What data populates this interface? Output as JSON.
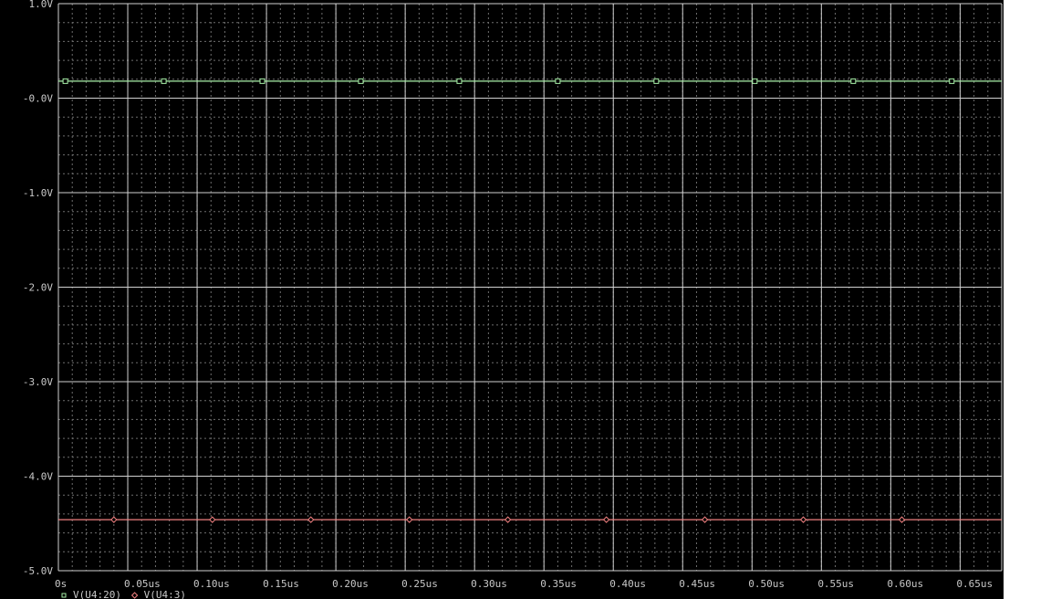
{
  "chart_data": {
    "type": "line",
    "title": "",
    "xlabel": "",
    "ylabel": "",
    "xlim": [
      0,
      0.68
    ],
    "ylim": [
      -5.0,
      1.0
    ],
    "grid": true,
    "x_tick_values": [
      0,
      0.05,
      0.1,
      0.15,
      0.2,
      0.25,
      0.3,
      0.35,
      0.4,
      0.45,
      0.5,
      0.55,
      0.6,
      0.65
    ],
    "x_tick_labels": [
      "0s",
      "0.05us",
      "0.10us",
      "0.15us",
      "0.20us",
      "0.25us",
      "0.30us",
      "0.35us",
      "0.40us",
      "0.45us",
      "0.50us",
      "0.55us",
      "0.60us",
      "0.65us"
    ],
    "y_tick_values": [
      1.0,
      0.0,
      -1.0,
      -2.0,
      -3.0,
      -4.0,
      -5.0
    ],
    "y_tick_labels": [
      "1.0V",
      "-0.0V",
      "-1.0V",
      "-2.0V",
      "-3.0V",
      "-4.0V",
      "-5.0V"
    ],
    "series": [
      {
        "name": "V(U4:20)",
        "color": "#a8f0a8",
        "marker": "square",
        "x": [
          0,
          0.68
        ],
        "y": [
          0.18,
          0.18
        ],
        "marker_x": [
          0.005,
          0.076,
          0.147,
          0.218,
          0.289,
          0.36,
          0.431,
          0.502,
          0.573,
          0.644
        ]
      },
      {
        "name": "V(U4:3)",
        "color": "#f08080",
        "marker": "diamond",
        "x": [
          0,
          0.68
        ],
        "y": [
          -4.46,
          -4.46
        ],
        "marker_x": [
          0.04,
          0.111,
          0.182,
          0.253,
          0.324,
          0.395,
          0.466,
          0.537,
          0.608
        ]
      }
    ]
  }
}
